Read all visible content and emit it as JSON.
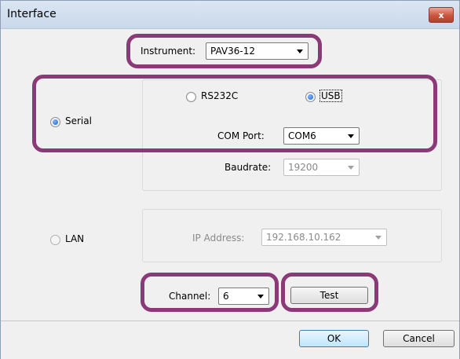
{
  "window": {
    "title": "Interface",
    "close_glyph": "x"
  },
  "instrument": {
    "label": "Instrument:",
    "value": "PAV36-12"
  },
  "serial": {
    "label": "Serial",
    "selected": true,
    "rs232c_label": "RS232C",
    "usb_label": "USB",
    "usb_selected": true,
    "com_port_label": "COM Port:",
    "com_port_value": "COM6",
    "baudrate_label": "Baudrate:",
    "baudrate_value": "19200"
  },
  "lan": {
    "label": "LAN",
    "selected": false,
    "ip_label": "IP Address:",
    "ip_value": "192.168.10.162"
  },
  "channel": {
    "label": "Channel:",
    "value": "6"
  },
  "buttons": {
    "test": "Test",
    "ok": "OK",
    "cancel": "Cancel"
  },
  "colors": {
    "highlight": "#8b3a78",
    "accent": "#1b5fd6"
  }
}
